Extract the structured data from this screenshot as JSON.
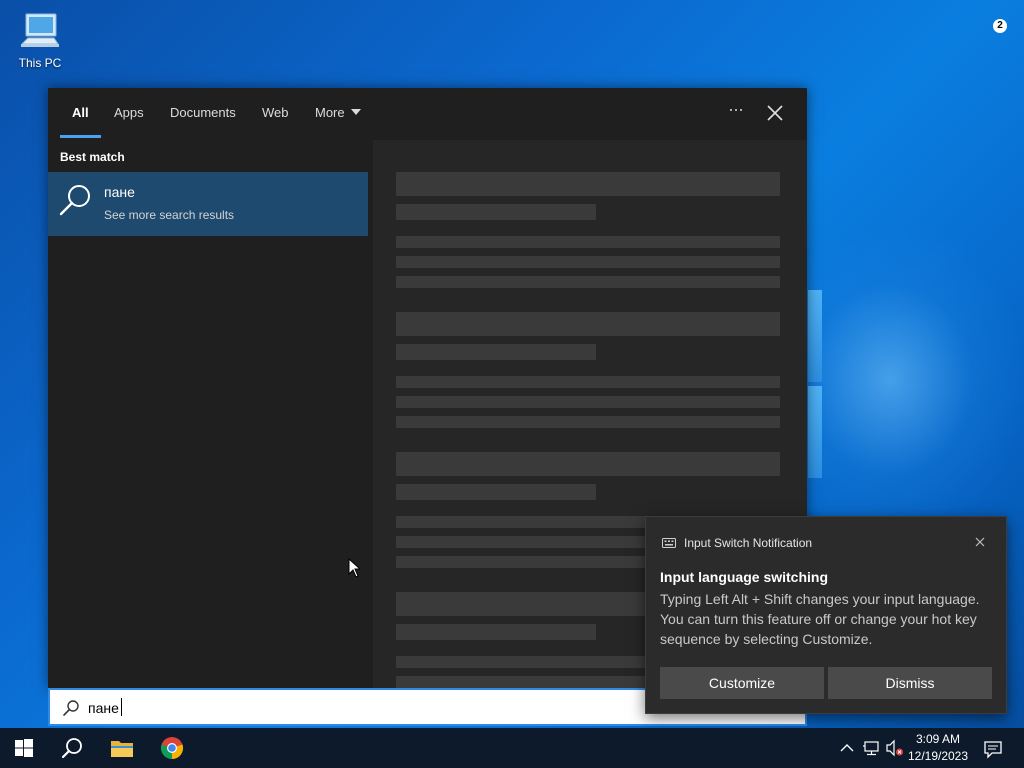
{
  "desktop": {
    "icons": [
      {
        "label": "This PC",
        "icon": "computer-icon"
      }
    ]
  },
  "search_panel": {
    "tabs": [
      {
        "label": "All",
        "active": true
      },
      {
        "label": "Apps",
        "active": false
      },
      {
        "label": "Documents",
        "active": false
      },
      {
        "label": "Web",
        "active": false
      },
      {
        "label": "More",
        "active": false,
        "has_dropdown": true
      }
    ],
    "best_match_heading": "Best match",
    "best_match": {
      "title": "пане",
      "subtitle": "See more search results",
      "icon": "search-icon"
    },
    "preview_state": "loading"
  },
  "search_box": {
    "value": "пане",
    "icon": "search-icon"
  },
  "notification": {
    "app_name": "Input Switch Notification",
    "title": "Input language switching",
    "body": "Typing Left Alt + Shift changes your input language. You can turn this feature off or change your hot key sequence by selecting Customize.",
    "buttons": {
      "customize": "Customize",
      "dismiss": "Dismiss"
    }
  },
  "taskbar": {
    "pinned": [
      "windows-start-icon",
      "search-icon",
      "file-explorer-icon",
      "chrome-icon"
    ],
    "tray": [
      "chevron-up-icon",
      "network-icon",
      "volume-muted-icon"
    ],
    "clock": {
      "time": "3:09 AM",
      "date": "12/19/2023"
    },
    "notification_count": "2"
  },
  "colors": {
    "accent": "#4aa3f0",
    "selected_item": "#1d4a6e",
    "panel_bg": "#1f1f1f",
    "toast_bg": "#2b2b2b",
    "taskbar_bg": "#0d1a2b"
  }
}
